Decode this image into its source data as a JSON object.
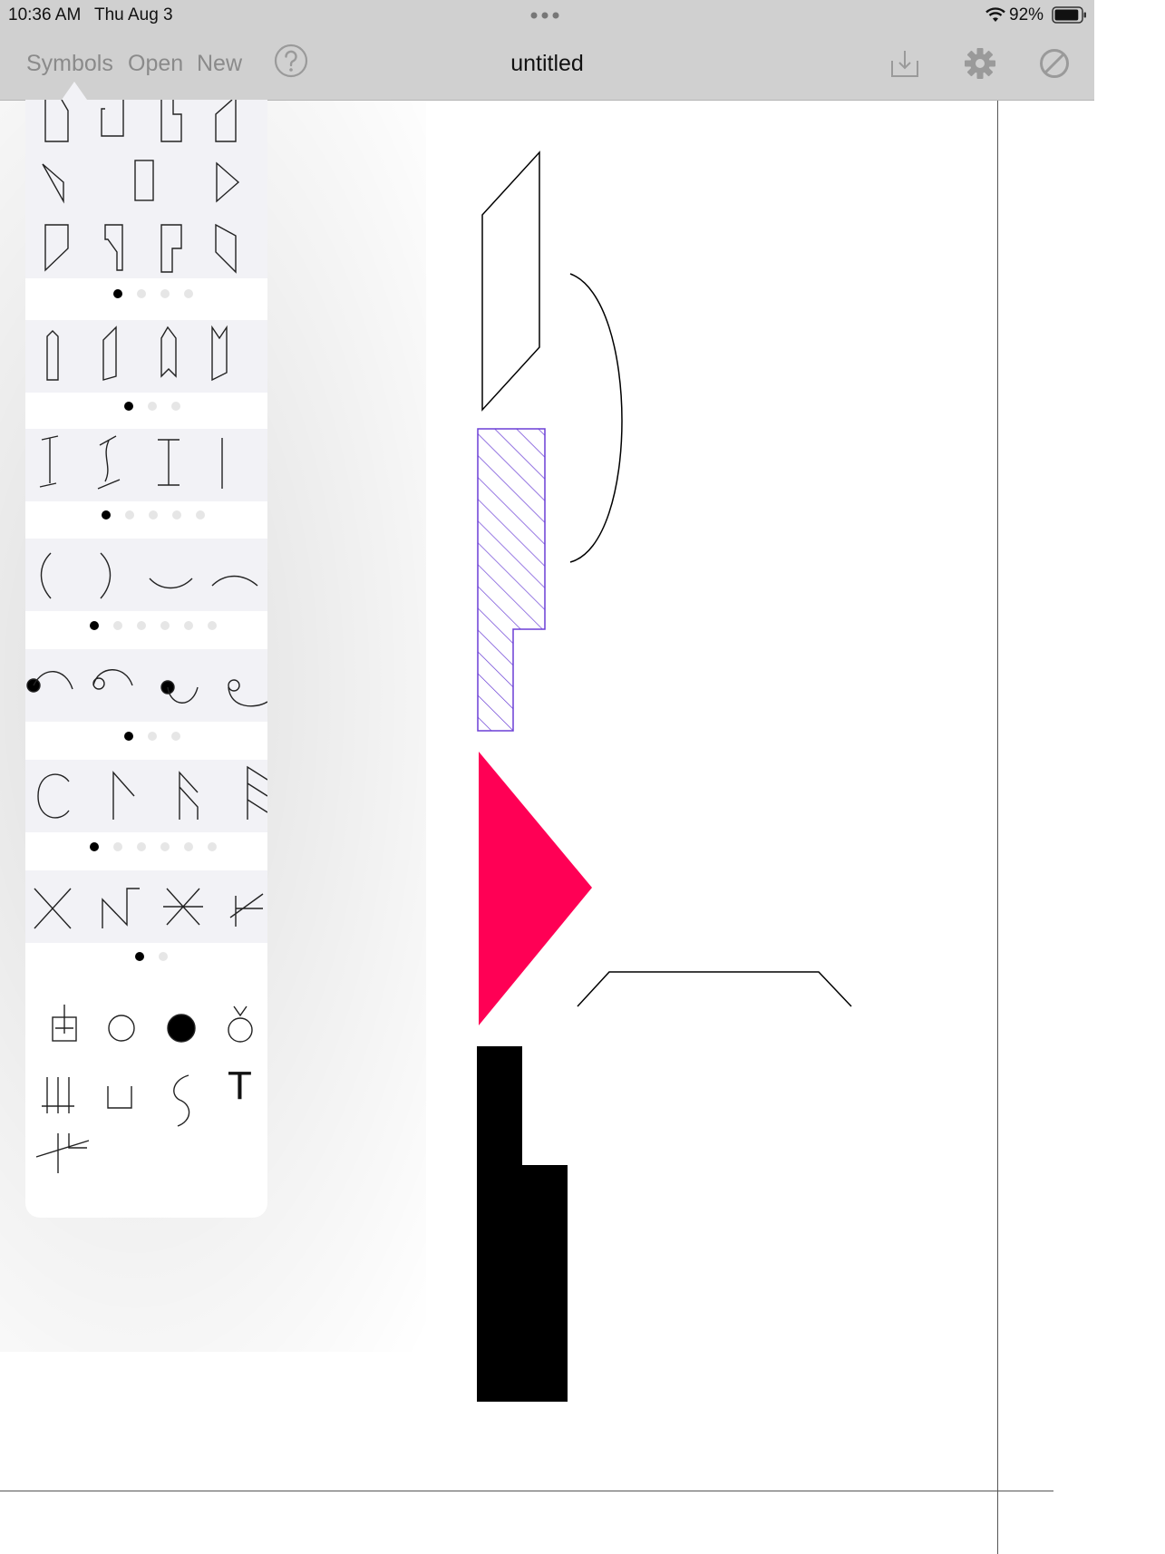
{
  "status_bar": {
    "time": "10:36 AM",
    "date": "Thu Aug 3",
    "battery_percent": "92%",
    "multitask_icon": "ellipsis-dots-icon",
    "wifi_icon": "wifi-icon",
    "battery_icon": "battery-icon",
    "battery_level": 0.92
  },
  "toolbar": {
    "symbols_label": "Symbols",
    "open_label": "Open",
    "new_label": "New",
    "title": "untitled",
    "help_icon": "question-circle-icon",
    "export_icon": "download-tray-icon",
    "settings_icon": "gear-icon",
    "clear_icon": "prohibit-icon"
  },
  "symbol_palette": {
    "groups": [
      {
        "name": "blocks",
        "symbols": [
          "block-notch-top-left",
          "block-notch-left",
          "block-notch-right",
          "block-slant-top",
          "triangle-left",
          "block-tall",
          "triangle-right",
          "block-slant-bottom",
          "block-notch-bottom-left",
          "block-notch-bottom-right",
          "block-slant-right"
        ],
        "page_count": 4,
        "active_page": 1
      },
      {
        "name": "ribbons",
        "symbols": [
          "ribbon-straight",
          "ribbon-slant",
          "ribbon-point",
          "ribbon-fold"
        ],
        "page_count": 3,
        "active_page": 1
      },
      {
        "name": "beams",
        "symbols": [
          "beam-i-slanted",
          "beam-i-curved",
          "beam-i",
          "beam-line"
        ],
        "page_count": 5,
        "active_page": 1
      },
      {
        "name": "arcs",
        "symbols": [
          "paren-left",
          "paren-right",
          "arc-smile",
          "arc-frown"
        ],
        "page_count": 6,
        "active_page": 1
      },
      {
        "name": "hooks",
        "symbols": [
          "hook-dot-left",
          "hook-loop-left",
          "hook-dot-down",
          "hook-loop-down"
        ],
        "page_count": 3,
        "active_page": 1
      },
      {
        "name": "flags",
        "symbols": [
          "c-curve",
          "flag-single",
          "flag-double",
          "flag-triple"
        ],
        "page_count": 6,
        "active_page": 1
      },
      {
        "name": "crosses",
        "symbols": [
          "x-cross",
          "n-zigzag",
          "asterisk-cross",
          "slash-cross"
        ],
        "page_count": 2,
        "active_page": 1
      },
      {
        "name": "misc",
        "symbols": [
          "box-plus",
          "circle-open",
          "circle-filled",
          "circle-accent",
          "triple-bar",
          "cup",
          "s-curve",
          "text-tool",
          "branch"
        ]
      }
    ],
    "text_tool_label": "T"
  },
  "canvas": {
    "shapes": [
      {
        "type": "parallelogram-outline",
        "color": "#000000"
      },
      {
        "type": "arc-bracket",
        "color": "#000000"
      },
      {
        "type": "hatched-block",
        "color": "#6b3fd6"
      },
      {
        "type": "filled-triangle",
        "color": "#ff0055"
      },
      {
        "type": "hat-line",
        "color": "#000000"
      },
      {
        "type": "filled-step-block",
        "color": "#000000"
      }
    ]
  }
}
